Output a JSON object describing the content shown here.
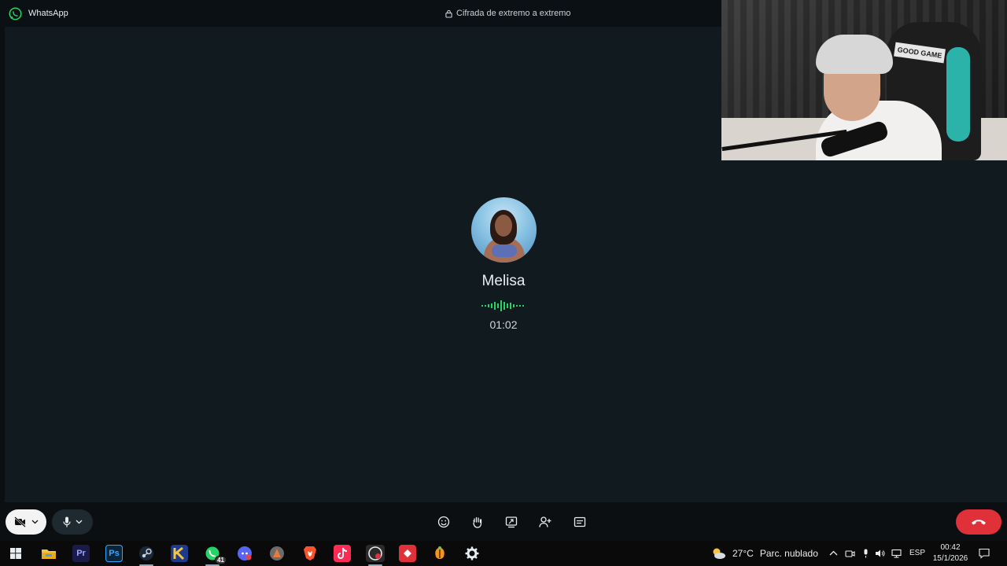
{
  "titlebar": {
    "app_name": "WhatsApp",
    "encryption_label": "Cifrada de extremo a extremo"
  },
  "call": {
    "contact_name": "Melisa",
    "duration": "01:02"
  },
  "webcam": {
    "chair_label": "GOOD GAME"
  },
  "controls": {
    "camera": {
      "icon": "video-off-icon",
      "state": "off"
    },
    "microphone": {
      "icon": "mic-icon",
      "state": "on"
    },
    "center_buttons": [
      {
        "name": "reactions-button",
        "icon": "emoji-icon"
      },
      {
        "name": "raise-hand-button",
        "icon": "hand-icon"
      },
      {
        "name": "share-screen-button",
        "icon": "share-screen-icon"
      },
      {
        "name": "add-participant-button",
        "icon": "add-person-icon"
      },
      {
        "name": "more-options-button",
        "icon": "captions-icon"
      }
    ],
    "end_call": {
      "icon": "hang-up-icon",
      "color": "#e0303a"
    }
  },
  "taskbar": {
    "apps": [
      {
        "name": "start-button",
        "icon": "windows-icon"
      },
      {
        "name": "file-explorer",
        "icon": "folder-icon"
      },
      {
        "name": "premiere-pro",
        "icon": "premiere-icon",
        "label": "Pr"
      },
      {
        "name": "photoshop",
        "icon": "photoshop-icon",
        "label": "Ps"
      },
      {
        "name": "steam",
        "icon": "steam-icon"
      },
      {
        "name": "app-k",
        "icon": "k-icon"
      },
      {
        "name": "whatsapp",
        "icon": "whatsapp-icon",
        "badge": "41"
      },
      {
        "name": "discord",
        "icon": "discord-icon"
      },
      {
        "name": "game-app",
        "icon": "game-icon"
      },
      {
        "name": "brave",
        "icon": "brave-icon"
      },
      {
        "name": "tiktok",
        "icon": "tiktok-icon"
      },
      {
        "name": "obs-like",
        "icon": "record-icon"
      },
      {
        "name": "red-app",
        "icon": "red-app-icon"
      },
      {
        "name": "fl-studio",
        "icon": "fl-studio-icon"
      },
      {
        "name": "settings",
        "icon": "gear-icon"
      }
    ],
    "weather": {
      "temperature": "27°C",
      "condition": "Parc. nublado"
    },
    "language": "ESP",
    "time": "00:42",
    "date": "15/1/2026"
  },
  "colors": {
    "whatsapp_green": "#25d366",
    "end_call_red": "#e0303a",
    "background": "#111a1f"
  }
}
